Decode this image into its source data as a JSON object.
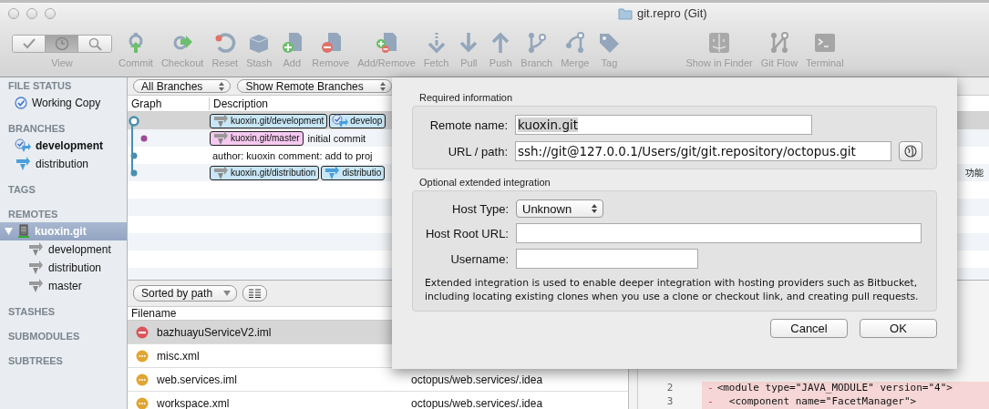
{
  "window": {
    "title": "git.repro (Git)"
  },
  "toolbar": {
    "view_label": "View",
    "view_modes": [
      {
        "selected": false
      },
      {
        "selected": true
      },
      {
        "selected": false
      }
    ],
    "buttons": [
      {
        "label": "Commit"
      },
      {
        "label": "Checkout"
      },
      {
        "label": "Reset"
      },
      {
        "label": "Stash"
      },
      {
        "label": "Add"
      },
      {
        "label": "Remove"
      },
      {
        "label": "Add/Remove"
      },
      {
        "label": "Fetch"
      },
      {
        "label": "Pull"
      },
      {
        "label": "Push"
      },
      {
        "label": "Branch"
      },
      {
        "label": "Merge"
      },
      {
        "label": "Tag"
      },
      {
        "label": "Show in Finder"
      },
      {
        "label": "Git Flow"
      },
      {
        "label": "Terminal"
      }
    ]
  },
  "sidebar": {
    "sections": [
      {
        "title": "FILE STATUS",
        "items": [
          {
            "label": "Working Copy",
            "kind": "status",
            "selected": false
          }
        ]
      },
      {
        "title": "BRANCHES",
        "items": [
          {
            "label": "development",
            "kind": "current_branch",
            "selected": false
          },
          {
            "label": "distribution",
            "kind": "branch",
            "selected": false
          }
        ]
      },
      {
        "title": "TAGS"
      },
      {
        "title": "REMOTES",
        "items": [
          {
            "label": "kuoxin.git",
            "kind": "remote",
            "selected": true,
            "expanded": true,
            "children": [
              {
                "label": "development",
                "kind": "remote_branch",
                "selected": false
              },
              {
                "label": "distribution",
                "kind": "remote_branch",
                "selected": false
              },
              {
                "label": "master",
                "kind": "remote_branch",
                "selected": false
              }
            ]
          }
        ]
      },
      {
        "title": "STASHES"
      },
      {
        "title": "SUBMODULES"
      },
      {
        "title": "SUBTREES"
      }
    ]
  },
  "branch_filters": [
    "All Branches",
    "Show Remote Branches"
  ],
  "history": {
    "columns": [
      "Graph",
      "Description"
    ],
    "rows": [
      {
        "selected": true,
        "kind": "head",
        "color": "#4a8fb0",
        "refs": [
          {
            "label": "kuoxin.git/development",
            "kind": "remote",
            "color": "#c8e6f5"
          },
          {
            "label": "develop",
            "kind": "current",
            "color": "#c8e6f5"
          }
        ]
      },
      {
        "selected": false,
        "kind": "side",
        "color": "#a0489a",
        "refs": [
          {
            "label": "kuoxin.git/master",
            "kind": "remote",
            "color": "#f6c9f0"
          }
        ],
        "message": "initial commit"
      },
      {
        "selected": false,
        "kind": "commit",
        "color": "#4a8fb0",
        "message": "author: kuoxin comment: add to proj"
      },
      {
        "selected": false,
        "kind": "commit",
        "color": "#4a8fb0",
        "refs": [
          {
            "label": "kuoxin.git/distribution",
            "kind": "remote",
            "color": "#c8e6f5"
          },
          {
            "label": "distributio",
            "kind": "branch",
            "color": "#c8e6f5"
          }
        ],
        "column_3": "功能"
      }
    ]
  },
  "files": {
    "sort": "Sorted by path",
    "columns": [
      "Filename"
    ],
    "rows": [
      {
        "name": "bazhuayuServiceV2.iml",
        "kind": "removed",
        "selected": true
      },
      {
        "name": "misc.xml",
        "kind": "modified",
        "selected": false
      },
      {
        "name": "web.services.iml",
        "kind": "modified",
        "selected": false,
        "path": "octopus/web.services/.idea"
      },
      {
        "name": "workspace.xml",
        "kind": "modified",
        "selected": false,
        "path": "octopus/web.services/.idea"
      }
    ]
  },
  "diff": {
    "lines": [
      {
        "number": "2",
        "sign": "-",
        "text": "<module type=\"JAVA_MODULE\" version=\"4\">",
        "kind": "removed"
      },
      {
        "number": "3",
        "sign": "-",
        "text": "  <component name=\"FacetManager\">",
        "kind": "removed"
      }
    ]
  },
  "dialog": {
    "required_heading": "Required information",
    "remote_name": {
      "label": "Remote name:",
      "value": "kuoxin.git",
      "text_selected": true
    },
    "url": {
      "label": "URL / path:",
      "value": "ssh://git@127.0.0.1/Users/git/git.repository/octopus.git"
    },
    "optional_heading": "Optional extended integration",
    "host_type": {
      "label": "Host Type:",
      "value": "Unknown"
    },
    "host_root_url": {
      "label": "Host Root URL:"
    },
    "username": {
      "label": "Username:"
    },
    "note": "Extended integration is used to enable deeper integration with hosting providers such as Bitbucket, including locating existing clones when you use a clone or checkout link, and creating pull requests.",
    "buttons": [
      {
        "label": "Cancel"
      },
      {
        "label": "OK"
      }
    ]
  }
}
